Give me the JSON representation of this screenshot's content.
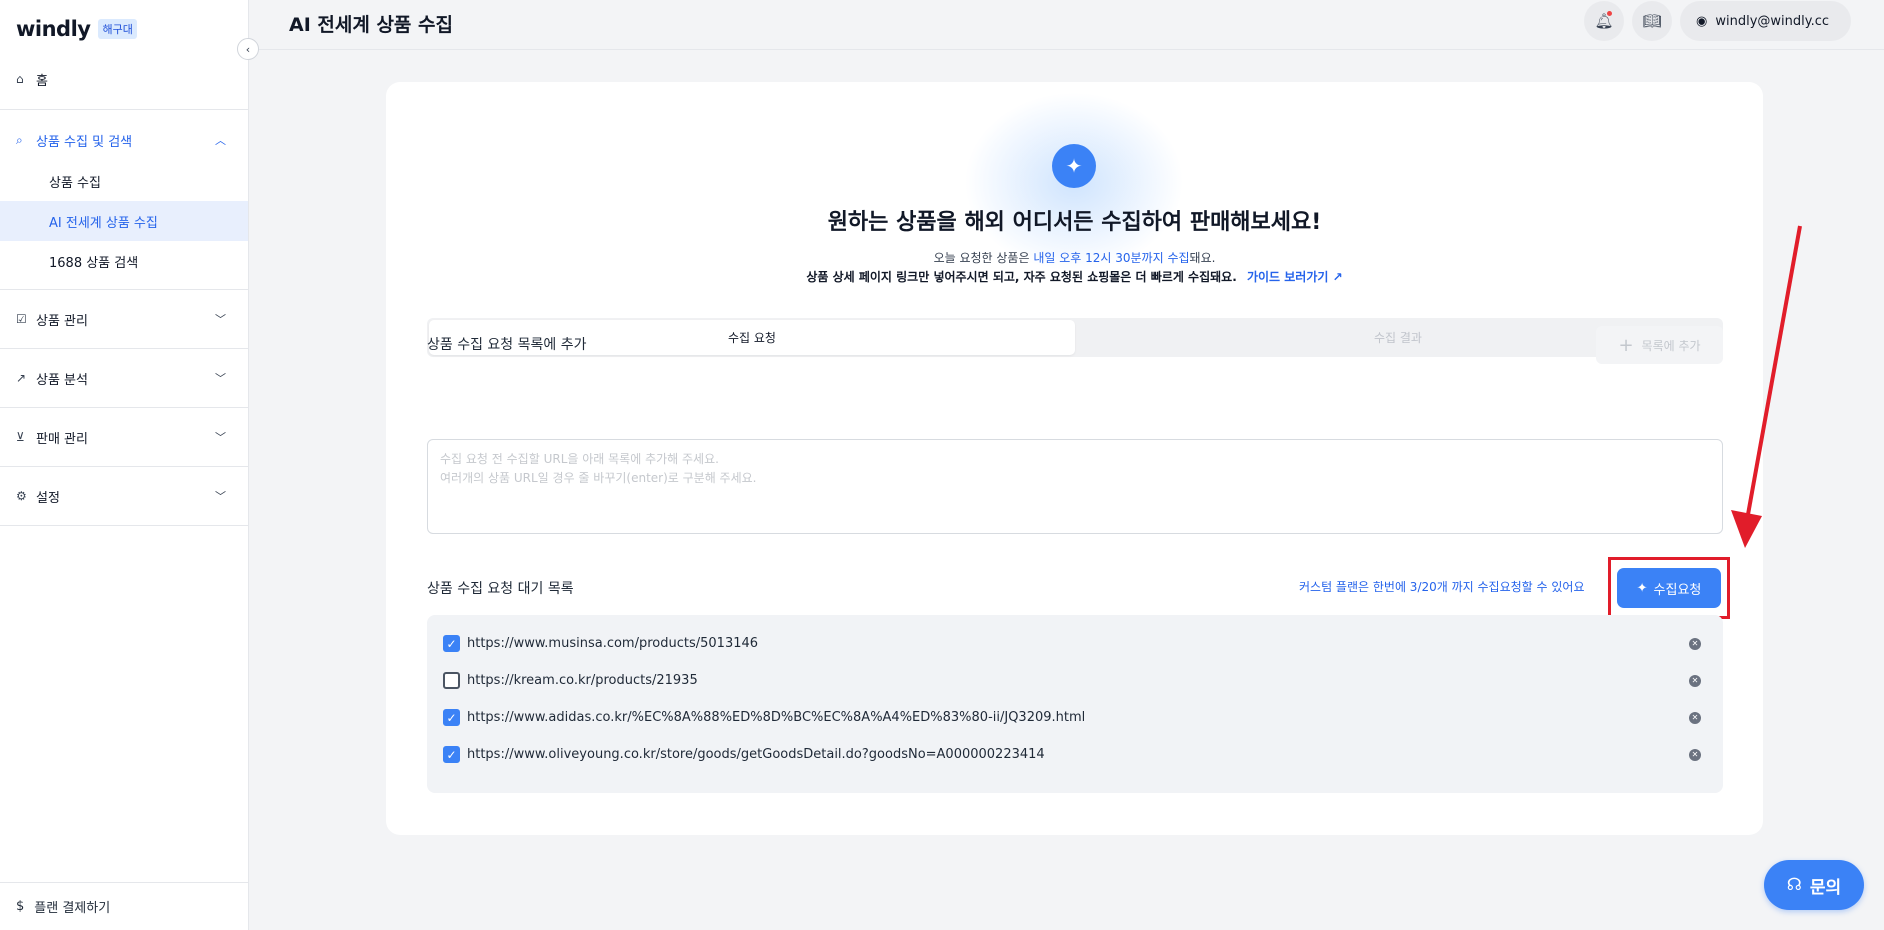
{
  "brand": {
    "logo": "windly",
    "badge": "해구대"
  },
  "sidebar": {
    "home": "홈",
    "groups": [
      {
        "label": "상품 수집 및 검색",
        "expanded": true,
        "items": [
          {
            "label": "상품 수집"
          },
          {
            "label": "AI 전세계 상품 수집",
            "selected": true
          },
          {
            "label": "1688 상품 검색"
          }
        ]
      },
      {
        "label": "상품 관리"
      },
      {
        "label": "상품 분석"
      },
      {
        "label": "판매 관리"
      },
      {
        "label": "설정"
      }
    ],
    "plan_payment": "플랜 결제하기"
  },
  "header": {
    "title": "AI 전세계 상품 수집",
    "user_email": "windly@windly.cc"
  },
  "hero": {
    "title": "원하는 상품을 해외 어디서든 수집하여 판매해보세요!",
    "line1_pre": "오늘 요청한 상품은 ",
    "line1_highlight": "내일 오후 12시 30분까지 수집",
    "line1_post": "돼요.",
    "line2": "상품 상세 페이지 링크만 넣어주시면 되고, 자주 요청된 쇼핑몰은 더 빠르게 수집돼요.",
    "guide_link": "가이드 보러가기"
  },
  "tabs": [
    {
      "label": "수집 요청",
      "active": true
    },
    {
      "label": "수집 결과",
      "active": false
    }
  ],
  "add_section": {
    "label": "상품 수집 요청 목록에 추가",
    "add_button": "목록에 추가",
    "textarea_placeholder": "수집 요청 전 수집할 URL을 아래 목록에 추가해 주세요.\n여러개의 상품 URL일 경우 줄 바꾸기(enter)로 구분해 주세요."
  },
  "queue_section": {
    "label": "상품 수집 요청 대기 목록",
    "plan_note": "커스텀 플랜은 한번에 3/20개 까지 수집요청할 수 있어요",
    "request_button": "수집요청",
    "items": [
      {
        "url": "https://www.musinsa.com/products/5013146",
        "checked": true
      },
      {
        "url": "https://kream.co.kr/products/21935",
        "checked": false
      },
      {
        "url": "https://www.adidas.co.kr/%EC%8A%88%ED%8D%BC%EC%8A%A4%ED%83%80-ii/JQ3209.html",
        "checked": true
      },
      {
        "url": "https://www.oliveyoung.co.kr/store/goods/getGoodsDetail.do?goodsNo=A000000223414",
        "checked": true
      }
    ]
  },
  "help_button": "문의",
  "colors": {
    "accent": "#3b82f6",
    "annotation": "#e11d2a"
  }
}
